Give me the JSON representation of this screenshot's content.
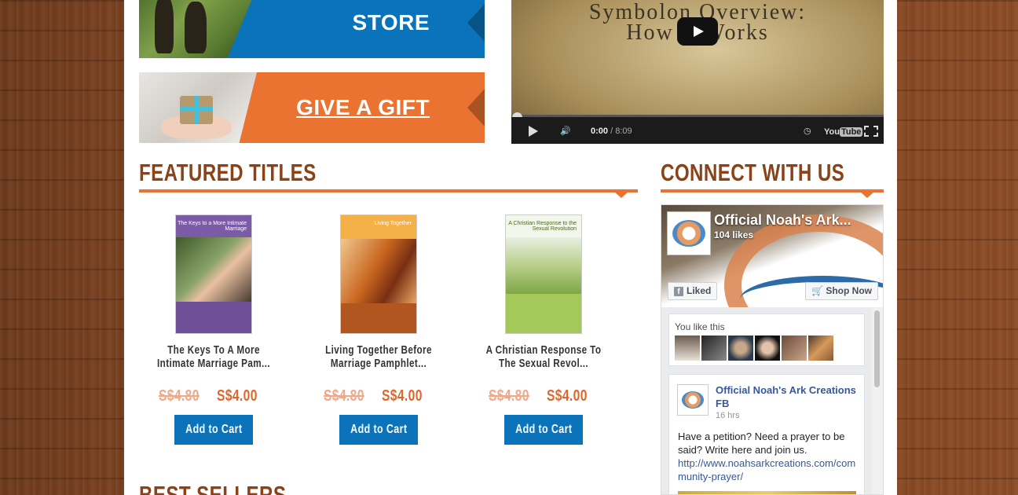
{
  "banners": {
    "store": "STORE",
    "gift": "GIVE A GIFT"
  },
  "video": {
    "title_line1": "Symbolon Overview:",
    "title_line2": "How It Works",
    "current_time": "0:00",
    "duration": "/ 8:09",
    "youtube_label": "You",
    "youtube_tube": "Tube"
  },
  "featured": {
    "heading": "FEATURED TITLES",
    "products": [
      {
        "title": "The Keys To A More Intimate Marriage Pam...",
        "old_price": "S$4.80",
        "price": "S$4.00",
        "cart": "Add to Cart",
        "cover_text": "The Keys to a More Intimate Marriage",
        "cover_color": "#7b5aa6"
      },
      {
        "title": "Living Together Before Marriage Pamphlet...",
        "old_price": "S$4.80",
        "price": "S$4.00",
        "cart": "Add to Cart",
        "cover_text": "Living Together",
        "cover_color": "#f2a23a"
      },
      {
        "title": "A Christian Response To The Sexual Revol...",
        "old_price": "S$4.80",
        "price": "S$4.00",
        "cart": "Add to Cart",
        "cover_text": "A Christian Response to the Sexual Revolution",
        "cover_color": "#9cc24e"
      }
    ]
  },
  "connect": {
    "heading": "CONNECT WITH US"
  },
  "facebook": {
    "page_name": "Official Noah's Ark...",
    "likes": "104 likes",
    "liked_button": "Liked",
    "shop_button": "Shop Now",
    "you_like": "You like this",
    "post_author": "Official Noah's Ark Creations FB",
    "post_time": "16 hrs",
    "post_text": "Have a petition? Need a prayer to be said? Write here and join us.",
    "post_link": "http://www.noahsarkcreations.com/community-prayer/"
  },
  "best_sellers": {
    "heading": "BEST SELLERS"
  },
  "colors": {
    "brand_blue": "#0a73b9",
    "brand_orange": "#eb7331",
    "heading_brown": "#8b4218",
    "price_orange": "#e0662a",
    "facebook_link": "#365899"
  }
}
